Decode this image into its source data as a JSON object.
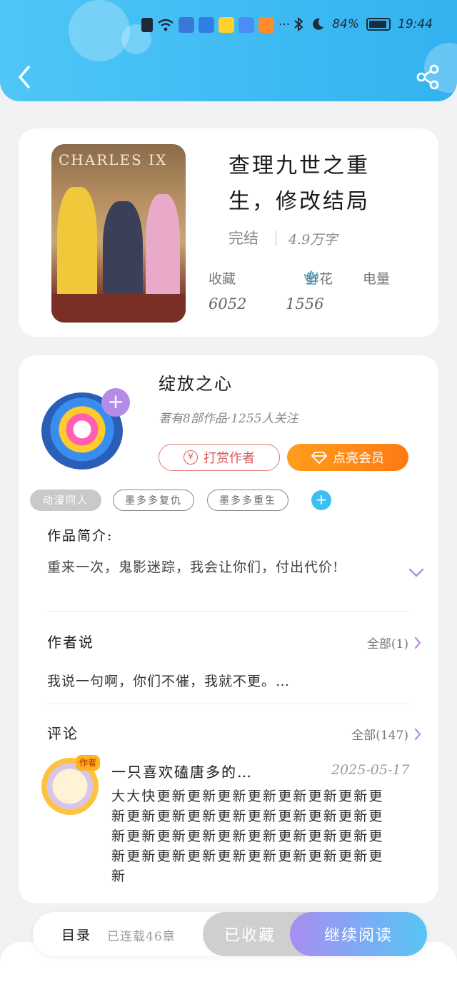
{
  "status_bar": {
    "battery": "84%",
    "time": "19:44",
    "more": "···"
  },
  "book": {
    "cover_text": "CHARLES IX",
    "title": "查理九世之重生，修改结局",
    "status": "完结",
    "word_count": "4.9万字",
    "stats": [
      {
        "label": "收藏",
        "value": "6052"
      },
      {
        "label": "鲜花",
        "value": "1556"
      },
      {
        "label": "电量",
        "value": ""
      }
    ]
  },
  "author": {
    "name": "绽放之心",
    "meta": "著有8部作品·1255人关注",
    "tip_label": "打赏作者",
    "vip_label": "点亮会员",
    "yen": "¥"
  },
  "tags": [
    "动漫同人",
    "墨多多复仇",
    "墨多多重生"
  ],
  "intro": {
    "title": "作品简介:",
    "text": "重来一次，鬼影迷踪，我会让你们，付出代价!"
  },
  "author_says": {
    "title": "作者说",
    "more": "全部(1)",
    "text": "我说一句啊，你们不催，我就不更。…"
  },
  "comments": {
    "title": "评论",
    "more": "全部(147)",
    "items": [
      {
        "badge": "作者",
        "user": "一只喜欢磕唐多的…",
        "date": "2025-05-17",
        "text": "大大快更新更新更新更新更新更新更新更新更新更新更新更新更新更新更新更新更新更新更新更新更新更新更新更新更新更新更新更新更新更新更新更新更新更新更新"
      }
    ]
  },
  "bottom_bar": {
    "toc": "目录",
    "chapters": "已连载46章",
    "favorited": "已收藏",
    "continue": "继续阅读"
  },
  "colors": {
    "header": "#33b2f0",
    "vip": "#ff8a15",
    "tip": "#d85a5a",
    "accent_purple": "#b58be8"
  }
}
